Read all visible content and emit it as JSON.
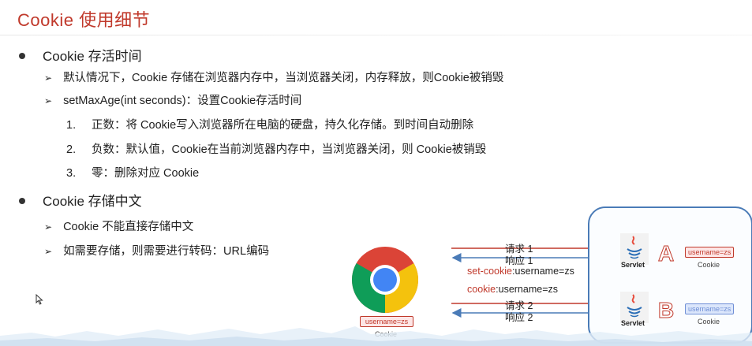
{
  "title": "Cookie 使用细节",
  "section1": {
    "heading": "Cookie 存活时间",
    "items": [
      "默认情况下，Cookie 存储在浏览器内存中，当浏览器关闭，内存释放，则Cookie被销毁",
      "setMaxAge(int seconds)：设置Cookie存活时间"
    ],
    "numbered": [
      {
        "n": "1.",
        "text": "正数：将 Cookie写入浏览器所在电脑的硬盘，持久化存储。到时间自动删除"
      },
      {
        "n": "2.",
        "text": "负数：默认值，Cookie在当前浏览器内存中，当浏览器关闭，则 Cookie被销毁"
      },
      {
        "n": "3.",
        "text": "零：删除对应 Cookie"
      }
    ]
  },
  "section2": {
    "heading": "Cookie 存储中文",
    "items": [
      "Cookie 不能直接存储中文",
      "如需要存储，则需要进行转码：URL编码"
    ]
  },
  "diagram": {
    "req1": "请求 1",
    "resp1": "响应 1",
    "set_cookie_key": "set-cookie",
    "set_cookie_val": ":username=zs",
    "cookie_key": "cookie",
    "cookie_val": ":username=zs",
    "req2": "请求 2",
    "resp2": "响应 2",
    "browser_cookie": "username=zs",
    "browser_cookie_caption": "Cookie",
    "server_a_letter": "A",
    "server_b_letter": "B",
    "servlet_label": "Servlet",
    "server_a_cookie": "username=zs",
    "server_a_caption": "Cookie",
    "server_b_cookie": "username=zs",
    "server_b_caption": "Cookie"
  },
  "colors": {
    "accent_red": "#c0392b",
    "accent_blue": "#4a7bb7"
  }
}
